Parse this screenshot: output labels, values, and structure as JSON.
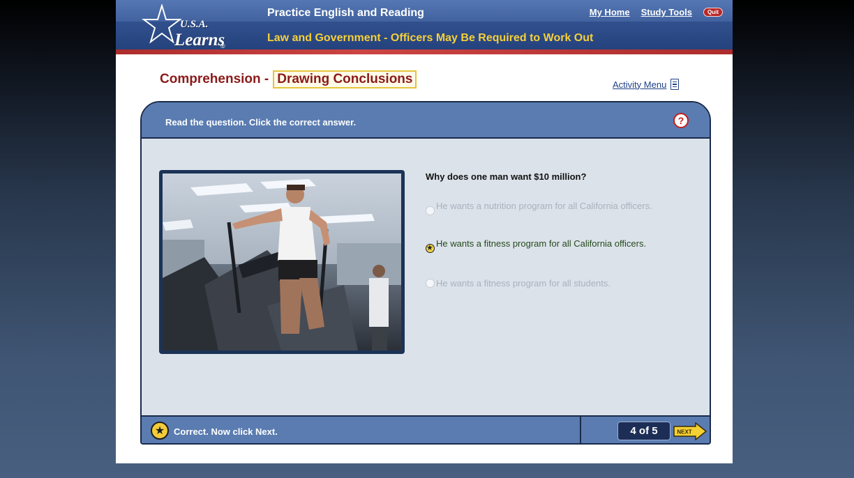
{
  "header": {
    "logo_usa": "U.S.A.",
    "logo_learns": "Learns",
    "logo_reg": "®",
    "site_title": "Practice English and Reading",
    "lesson_title": "Law and Government - Officers May Be Required to Work Out",
    "nav": {
      "my_home": "My Home",
      "study_tools": "Study Tools",
      "quit": "Quit"
    }
  },
  "activity": {
    "heading_main": "Comprehension -",
    "heading_sub": "Drawing Conclusions",
    "activity_menu": "Activity Menu",
    "instructions": "Read the question. Click the correct answer.",
    "help_glyph": "?",
    "question": "Why does one man want $10 million?",
    "options": [
      {
        "text": "He wants a nutrition program for all California officers.",
        "state": "dimmed"
      },
      {
        "text": "He wants a fitness program for all California officers.",
        "state": "selected"
      },
      {
        "text": "He wants a fitness program for all students.",
        "state": "dimmed"
      }
    ],
    "status": "Correct. Now click Next.",
    "page_count": "4 of 5",
    "next_label": "NEXT"
  },
  "colors": {
    "header_blue": "#3c5d9a",
    "lesson_title_yellow": "#f6cf3a",
    "heading_red": "#8b1a1a",
    "panel_blue": "#5a7cb1",
    "panel_body": "#dce2ea",
    "correct_green": "#244a1d"
  },
  "icons": {
    "help": "help-icon",
    "menu": "activity-menu-icon",
    "star": "star-icon",
    "next": "next-arrow-icon",
    "logo_star": "logo-star-icon"
  }
}
